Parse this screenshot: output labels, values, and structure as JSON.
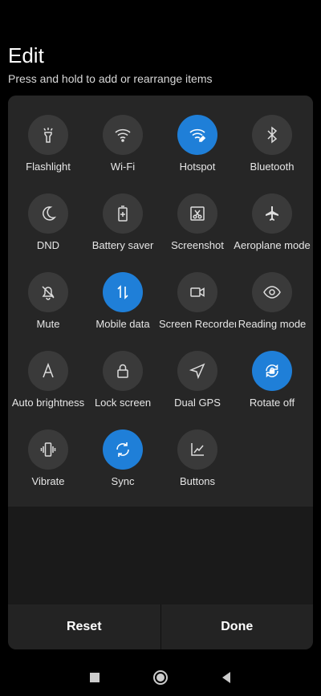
{
  "header": {
    "title": "Edit",
    "subtitle": "Press and hold to add or rearrange items"
  },
  "tiles": [
    {
      "label": "Flashlight",
      "icon": "flashlight-icon",
      "active": false
    },
    {
      "label": "Wi-Fi",
      "icon": "wifi-icon",
      "active": false
    },
    {
      "label": "Hotspot",
      "icon": "hotspot-icon",
      "active": true
    },
    {
      "label": "Bluetooth",
      "icon": "bluetooth-icon",
      "active": false
    },
    {
      "label": "DND",
      "icon": "moon-icon",
      "active": false
    },
    {
      "label": "Battery saver",
      "icon": "battery-saver-icon",
      "active": false
    },
    {
      "label": "Screenshot",
      "icon": "screenshot-icon",
      "active": false
    },
    {
      "label": "Aeroplane mode",
      "icon": "airplane-icon",
      "active": false
    },
    {
      "label": "Mute",
      "icon": "mute-bell-icon",
      "active": false
    },
    {
      "label": "Mobile data",
      "icon": "mobile-data-icon",
      "active": true
    },
    {
      "label": "Screen Recorder",
      "icon": "video-camera-icon",
      "active": false
    },
    {
      "label": "Reading mode",
      "icon": "eye-icon",
      "active": false
    },
    {
      "label": "Auto brightness",
      "icon": "auto-brightness-icon",
      "active": false
    },
    {
      "label": "Lock screen",
      "icon": "lock-icon",
      "active": false
    },
    {
      "label": "Dual GPS",
      "icon": "gps-navigation-icon",
      "active": false
    },
    {
      "label": "Rotate off",
      "icon": "rotate-lock-icon",
      "active": true
    },
    {
      "label": "Vibrate",
      "icon": "vibrate-icon",
      "active": false
    },
    {
      "label": "Sync",
      "icon": "sync-icon",
      "active": true
    },
    {
      "label": "Buttons",
      "icon": "buttons-icon",
      "active": false
    }
  ],
  "actions": {
    "reset": "Reset",
    "done": "Done"
  },
  "colors": {
    "active": "#1f7fd8",
    "inactive": "#3a3a3a"
  }
}
